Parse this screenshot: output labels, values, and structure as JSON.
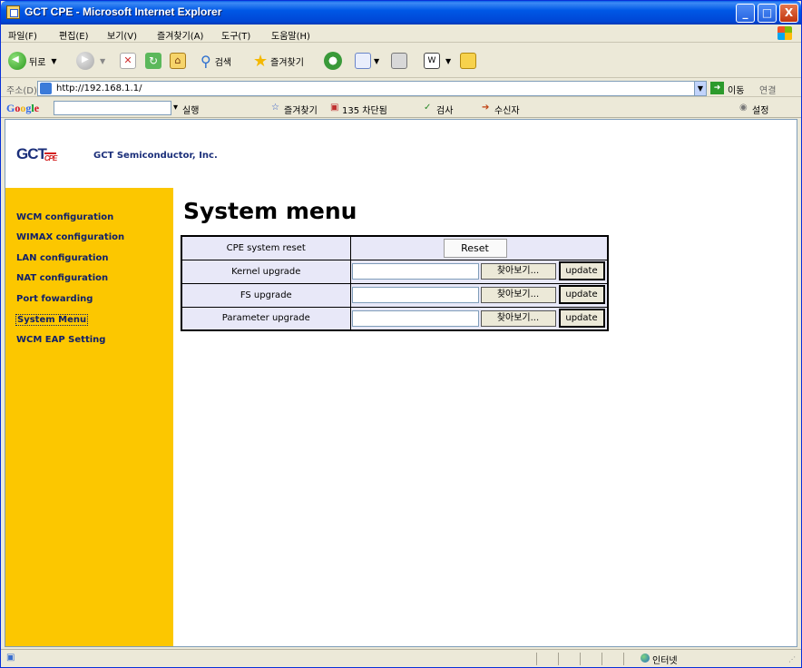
{
  "window": {
    "title": "GCT CPE - Microsoft Internet Explorer",
    "minimize": "_",
    "maximize": "□",
    "close": "X"
  },
  "menu": [
    "파일(F)",
    "편집(E)",
    "보기(V)",
    "즐겨찾기(A)",
    "도구(T)",
    "도움말(H)"
  ],
  "toolbar": {
    "back": "뒤로",
    "search": "검색",
    "favorites": "즐겨찾기"
  },
  "address": {
    "label": "주소(D)",
    "url": "http://192.168.1.1/",
    "go": "이동",
    "links": "연결"
  },
  "google_bar": {
    "logo": "Google",
    "search_btn": "실행",
    "favorites": "즐겨찾기",
    "blocked": "135 차단됨",
    "check": "검사",
    "autofill": "수신자",
    "settings": "설정"
  },
  "brand": {
    "logo": "GCT",
    "logo_sub": "CPE",
    "company": "GCT Semiconductor, Inc."
  },
  "nav": [
    {
      "label": "WCM configuration"
    },
    {
      "label": "WIMAX configuration"
    },
    {
      "label": "LAN configuration"
    },
    {
      "label": "NAT configuration"
    },
    {
      "label": "Port fowarding"
    },
    {
      "label": "System Menu"
    },
    {
      "label": "WCM EAP Setting"
    }
  ],
  "page": {
    "title": "System menu"
  },
  "system_table": {
    "reset_row": {
      "label": "CPE system reset",
      "button": "Reset"
    },
    "upgrade_rows": [
      {
        "label": "Kernel upgrade",
        "browse": "찾아보기...",
        "update": "update"
      },
      {
        "label": "FS upgrade",
        "browse": "찾아보기...",
        "update": "update"
      },
      {
        "label": "Parameter upgrade",
        "browse": "찾아보기...",
        "update": "update"
      }
    ]
  },
  "status": {
    "zone": "인터넷"
  },
  "colors": {
    "sidebar": "#fcc700",
    "nav_text": "#10206a",
    "title_bar": "#0058e6",
    "table_bg": "#e8e8f8"
  }
}
